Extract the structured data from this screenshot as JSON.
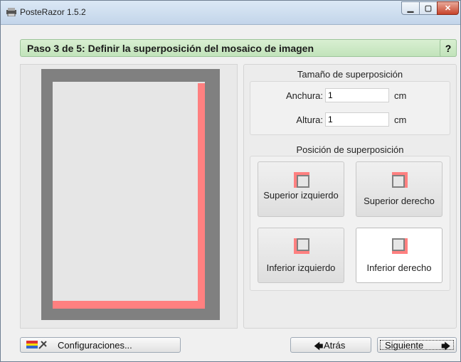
{
  "window": {
    "title": "PosteRazor 1.5.2",
    "icons": [
      "app-icon",
      "minimize-icon",
      "maximize-icon",
      "close-icon"
    ]
  },
  "header": {
    "step": "Paso 3 de 5: Definir la superposición del mosaico de imagen",
    "help_label": "?"
  },
  "size": {
    "title": "Tamaño de superposición",
    "width_label": "Anchura:",
    "width_value": "1",
    "width_unit": "cm",
    "height_label": "Altura:",
    "height_value": "1",
    "height_unit": "cm"
  },
  "position": {
    "title": "Posición de superposición",
    "top_left": "Superior izquierdo",
    "top_right": "Superior derecho",
    "bottom_left": "Inferior izquierdo",
    "bottom_right": "Inferior derecho",
    "selected": "bottom_right"
  },
  "footer": {
    "settings_label": "Configuraciones...",
    "back_label": "Atrás",
    "next_label": "Siguiente"
  },
  "colors": {
    "overlap": "#ff8080",
    "poster_border": "#808080",
    "paper": "#e6e6e6",
    "header_bg": "#c2e3bb"
  }
}
